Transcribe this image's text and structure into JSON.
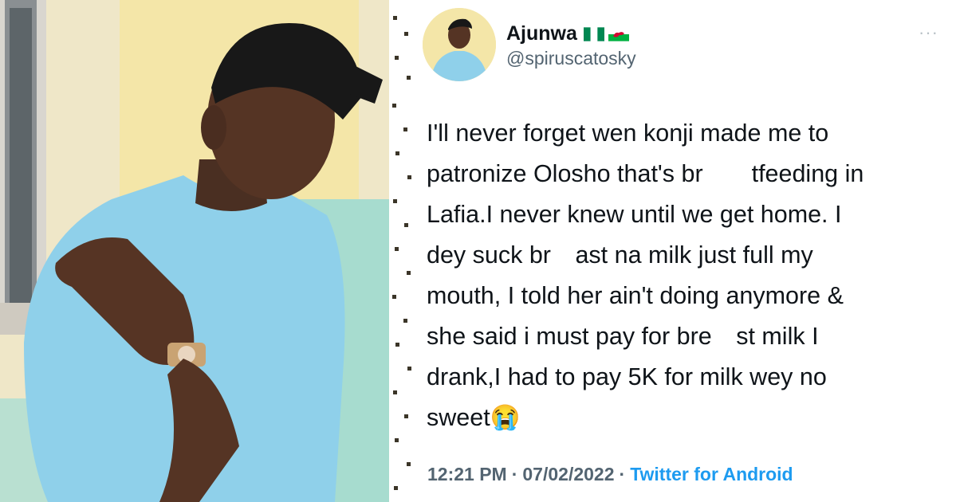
{
  "photo": {
    "icon": "person-photo"
  },
  "tweet": {
    "author_name": "Ajunwa",
    "author_flags": [
      "nigeria-flag-icon",
      "wales-flag-icon"
    ],
    "handle": "@spiruscatosky",
    "more_label": "···",
    "text": "I'll never forget wen konji made me to\npatronize Olosho that's br    tfeeding in\nLafia.I never knew until we get home. I\ndey suck br  ast na milk just full my\nmouth, I told her ain't doing anymore &\nshe said i must pay for bre  st milk I\ndrank,I had to pay 5K for milk wey no\nsweet😭",
    "time": "12:21 PM",
    "separator": "·",
    "date": "07/02/2022",
    "source": "Twitter for Android"
  },
  "colors": {
    "text": "#0f1419",
    "secondary": "#536471",
    "link": "#1d9bf0",
    "shirt": "#8fd0ea",
    "wall": "#f4e6a8"
  }
}
